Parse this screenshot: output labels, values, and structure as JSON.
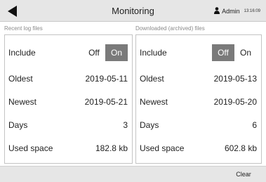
{
  "header": {
    "title": "Monitoring",
    "back_icon": "back-arrow-icon",
    "user_icon": "person-icon",
    "user": "Admin",
    "time": "13:16:09"
  },
  "recent": {
    "section_label": "Recent log files",
    "include_label": "Include",
    "off_label": "Off",
    "on_label": "On",
    "selected": "On",
    "oldest_label": "Oldest",
    "oldest_value": "2019-05-11",
    "newest_label": "Newest",
    "newest_value": "2019-05-21",
    "days_label": "Days",
    "days_value": "3",
    "space_label": "Used space",
    "space_value": "182.8 kb"
  },
  "archived": {
    "section_label": "Downloaded (archived) files",
    "include_label": "Include",
    "off_label": "Off",
    "on_label": "On",
    "selected": "Off",
    "oldest_label": "Oldest",
    "oldest_value": "2019-05-13",
    "newest_label": "Newest",
    "newest_value": "2019-05-20",
    "days_label": "Days",
    "days_value": "6",
    "space_label": "Used space",
    "space_value": "602.8 kb"
  },
  "footer": {
    "clear_label": "Clear"
  },
  "colors": {
    "bar_bg": "#e6e6e6",
    "toggle_active": "#7a7a7a",
    "panel_border": "#c4c4c4",
    "section_label": "#8a8a8a"
  }
}
